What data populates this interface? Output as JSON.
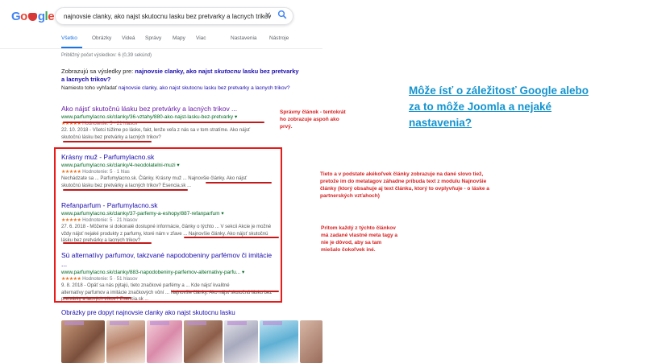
{
  "header": {
    "logo_text": "Google",
    "search_value": "najnovsie clanky, ako najst skutocnu lasku bez pretvarky a lacnych trikov",
    "clear_icon": "close-icon",
    "search_icon": "search-icon"
  },
  "tabs": [
    "Všetko",
    "Obrázky",
    "Videá",
    "Správy",
    "Mapy",
    "Viac",
    "Nastavenia",
    "Nástroje"
  ],
  "stats": "Približný počet výsledkov: 6 (0,39 sekúnd)",
  "correction": {
    "prefix": "Zobrazujú sa výsledky pre: ",
    "corrected_a": "najnovsie clanky, ako najst ",
    "corrected_em": "skutocnu",
    "corrected_b": " lasku bez pretvarky a lacnych trikov?",
    "instead_label": "Namiesto toho vyhľadať",
    "instead_query": "najnovsie clanky, ako najst skutocnu lasku bez pretvarky a lacnych trikov?"
  },
  "results": [
    {
      "title": "Ako nájsť skutočnú lásku bez pretvárky a lacných trikov ...",
      "url": "www.parfumylacno.sk/clanky/36-vztahy/880-ako-najst-lasku-bez-pretvarky",
      "stars": "★★★★★",
      "rating": "Hodnotenie: 5 · 21 hlasov",
      "snippet_1": "22. 10. 2018 - Všetci túžime po láske, fakt, lenže veľa z nás sa v tom stratíme. Ako nájsť",
      "snippet_2": "skutočnú lásku bez pretvárky a lacných trikov?"
    },
    {
      "title": "Krásny muž - Parfumylacno.sk",
      "url": "www.parfumylacno.sk/clanky/4-neodolatelni-muzi",
      "stars": "★★★★★",
      "rating": "Hodnotenie: 5 · 1 hlas",
      "snippet_1": "Nechádzate sa ... Parfumylacno.sk. Články. Krásny muž ...   Najnovšie články. Ako nájsť",
      "snippet_2": "skutočnú lásku bez pretvárky a lacných trikov? Esencia.sk ..."
    },
    {
      "title": "Refanparfum - Parfumylacno.sk",
      "url": "www.parfumylacno.sk/clanky/37-parfemy-a-eshopy/887-refanparfum",
      "stars": "★★★★★",
      "rating": "Hodnotenie: 5 · 21 hlasov",
      "snippet_1": "27. 6. 2018 - Môžeme si dokonalé dostupné informácie, články o týchto ... V sekcii Akcie je možné",
      "snippet_2": "vždy nájsť nejaké produkty z parfumy, ktoré nám v zľave ...   Najnovšie články. Ako nájsť skutočnú",
      "snippet_3": "lásku bez pretvárky a lacných trikov?"
    },
    {
      "title": "Sú alternatívy parfumov, takzvané napodobeniny parfémov či imitácie ...",
      "url": "www.parfumylacno.sk/clanky/883-napodobeniny-parfemov-alternativy-parfu...",
      "stars": "★★★★★",
      "rating": "Hodnotenie: 5 · 51 hlasov",
      "snippet_1": "9. 8. 2018 - Opäť sa nás pýtajú, tieto značkové parfémy a ... Kde nájsť kvalitné",
      "snippet_2": "alternatívy parfumov a imitácie značkových vôní ...   Najnovšie články. Ako nájsť skutočnú lásku bez",
      "snippet_3": "pretvárky a lacných trikov? Esencia.sk ..."
    }
  ],
  "images_title": "Obrázky pre dopyt najnovsie clanky ako najst skutocnu lasku",
  "annotations": {
    "correct": "Správny článok - tentokrát ho zobrazuje aspoň ako prvý.",
    "explain": "Tieto a v podstate akékoľvek články zobrazuje na dané slovo tiež, pretože im do metatagov záhadne príbuda text z modulu Najnovšie články (ktorý obsahuje aj text článku, ktorý to ovplyvňuje - o láske a partnerských vzťahoch)",
    "meta": "Pritom každý z týchto článkov má zadané vlastné meta tagy a nie je dôvod, aby sa tam miešalo čokoľvek iné.",
    "headline": "Môže ísť o záležitosť Google alebo za to môže Joomla a nejaké nastavenia?"
  },
  "colors": {
    "link": "#1a0dab",
    "visited": "#681da8",
    "url_green": "#006621",
    "annotation_red": "#d62020",
    "headline_blue": "#1493ce"
  }
}
